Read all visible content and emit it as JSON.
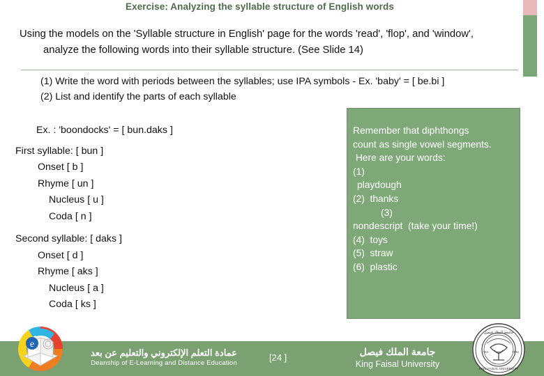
{
  "slide": {
    "title": "Exercise: Analyzing the syllable structure of English words",
    "intro_line1": "Using the models on the 'Syllable structure in English' page for the words 'read', 'flop', and 'window',",
    "intro_line2": "analyze the following words into their syllable structure.  (See Slide 14)",
    "instruction_1": "(1) Write the word with periods between the syllables; use IPA symbols - Ex. 'baby' = [ be.bi ]",
    "instruction_2": "(2) List and identify the parts of each syllable"
  },
  "analysis": {
    "example": "Ex. : 'boondocks'  =  [ bun.daks ]",
    "first_syllable": "First syllable:  [ bun ]",
    "first_onset": "Onset  [ b ]",
    "first_rhyme": "Rhyme [ un ]",
    "first_nucleus": "Nucleus [ u ]",
    "first_coda": "Coda    [ n ]",
    "second_syllable": "Second syllable:  [ daks ]",
    "second_onset": "Onset  [ d ]",
    "second_rhyme": "Rhyme [ aks ]",
    "second_nucleus": "Nucleus [ a ]",
    "second_coda": "Coda    [ ks ]"
  },
  "callout": {
    "line1": "Remember that diphthongs",
    "line2": "count as single vowel segments.",
    "line3": " Here are your words:",
    "item1_num": "(1)",
    "item1_word": "playdough",
    "item2": "(2)  thanks",
    "item3_num": "(3)",
    "item3_word": "nondescript  (take your time!)",
    "item4": "(4)  toys",
    "item5": "(5)  straw",
    "item6": "(6)  plastic"
  },
  "footer": {
    "deanship_ar": "عمادة التعلم الإلكتروني والتعليم عن بعد",
    "deanship_en": "Deanship of E-Learning and Distance Education",
    "page_number": "[24   ]",
    "university_ar": "جامعة الملك فيصل",
    "university_en": "King Faisal University"
  },
  "colors": {
    "title_green": "#4e6b4c",
    "callout_green": "#7fa878",
    "footer_green": "#7ba173",
    "edge_pink": "#e8b9bb",
    "edge_green": "#7aa678"
  }
}
